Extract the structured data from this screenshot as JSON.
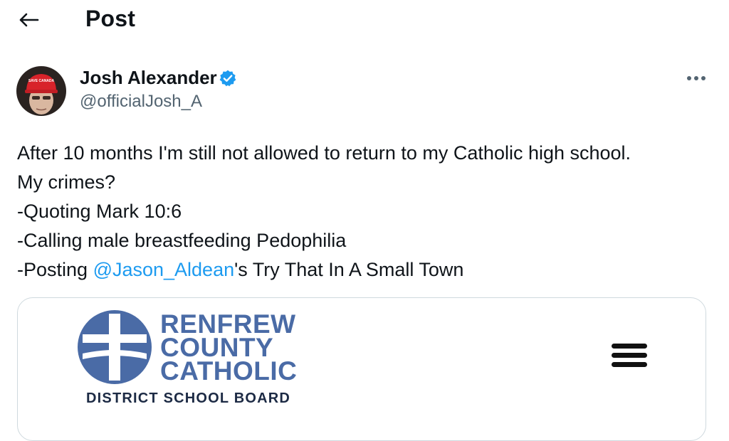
{
  "header": {
    "title": "Post",
    "back_icon": "arrow-left-icon"
  },
  "author": {
    "name": "Josh Alexander",
    "handle": "@officialJosh_A",
    "verified": true,
    "verified_color": "#1d9bf0",
    "cap_text": "SAVE CANADA"
  },
  "post": {
    "lines": [
      "After 10 months I'm still not allowed to return to my Catholic high school.",
      "My crimes?",
      "-Quoting Mark 10:6",
      "-Calling male breastfeeding Pedophilia"
    ],
    "last_line_prefix": "-Posting ",
    "mention": "@Jason_Aldean",
    "last_line_suffix": "'s Try That In A Small Town",
    "mention_color": "#1d9bf0"
  },
  "card": {
    "logo_line1": "RENFREW",
    "logo_line2": "COUNTY",
    "logo_line3": "CATHOLIC",
    "logo_sub": "DISTRICT SCHOOL BOARD",
    "menu_icon": "hamburger-menu-icon",
    "brand_color": "#4a6ba6"
  }
}
